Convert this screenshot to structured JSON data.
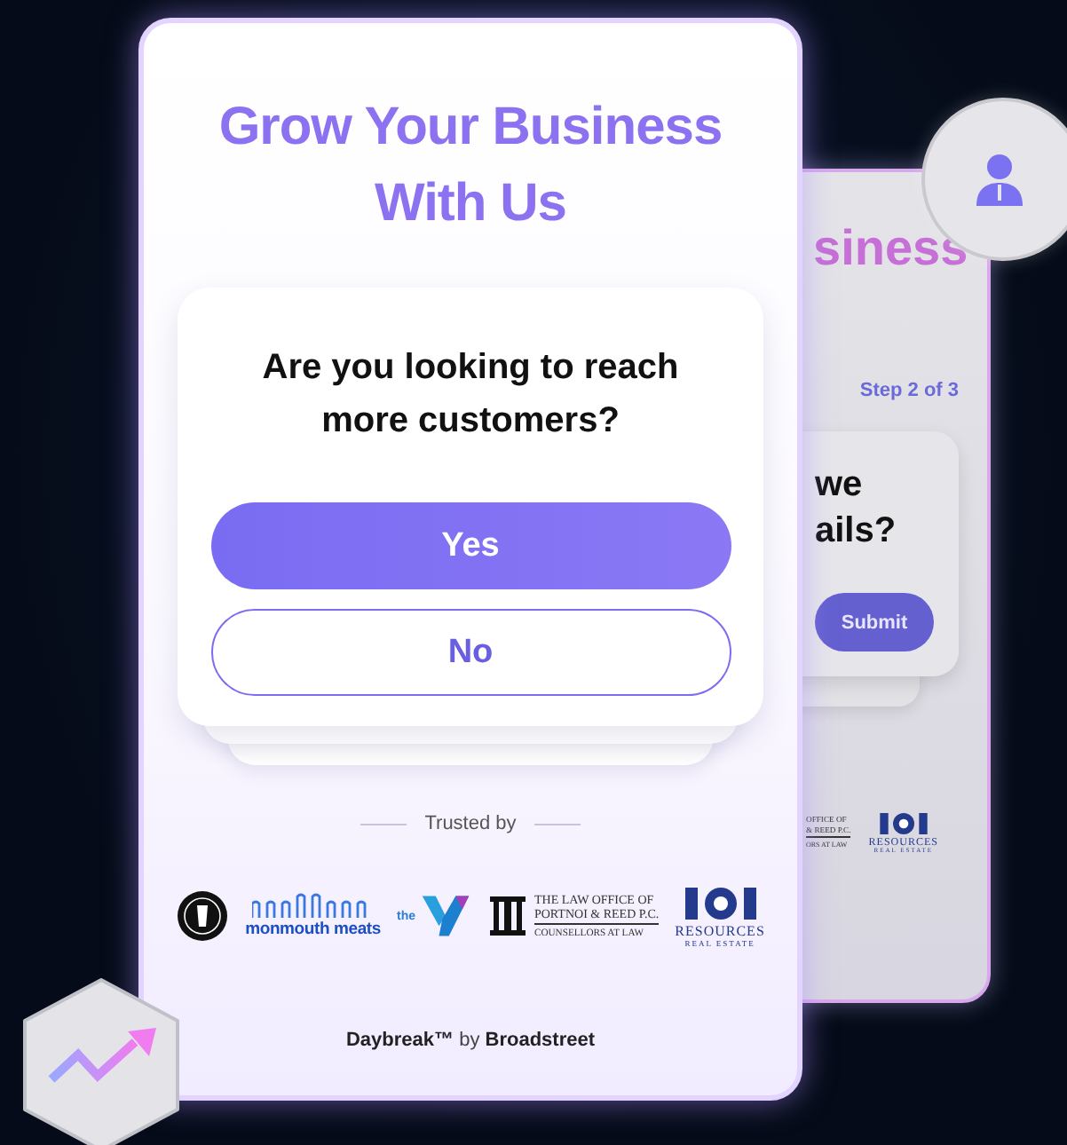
{
  "front_card": {
    "title": "Grow Your Business With Us",
    "question": "Are you looking to reach more customers?",
    "answers": [
      {
        "label": "Yes",
        "kind": "filled"
      },
      {
        "label": "No",
        "kind": "outlined"
      }
    ],
    "trusted_label": "Trusted by",
    "logos": [
      {
        "kind": "seal"
      },
      {
        "kind": "wordmark",
        "text": "monmouth meats"
      },
      {
        "kind": "emblem",
        "text": "the"
      },
      {
        "kind": "lawfirm",
        "lines": [
          "THE LAW OFFICE OF",
          "PORTNOI & REED P.C.",
          "COUNSELLORS AT LAW"
        ]
      },
      {
        "kind": "monogram",
        "text": "RESOURCES",
        "subtext": "REAL ESTATE"
      }
    ],
    "footer": "**Daybreak™** by **Broadstreet**"
  },
  "back_card": {
    "title": "siness",
    "step": "Step 2 of 3",
    "question_lines": [
      "we",
      "ails?"
    ],
    "button": "Submit",
    "logos": [
      {
        "kind": "lawfirm",
        "lines": [
          "OFFICE OF",
          "& REED P.C.",
          "ORS AT LAW"
        ]
      },
      {
        "kind": "monogram",
        "text": "RESOURCES",
        "subtext": "REAL ESTATE"
      }
    ]
  },
  "badges": [
    {
      "kind": "avatar"
    },
    {
      "kind": "growth"
    }
  ]
}
